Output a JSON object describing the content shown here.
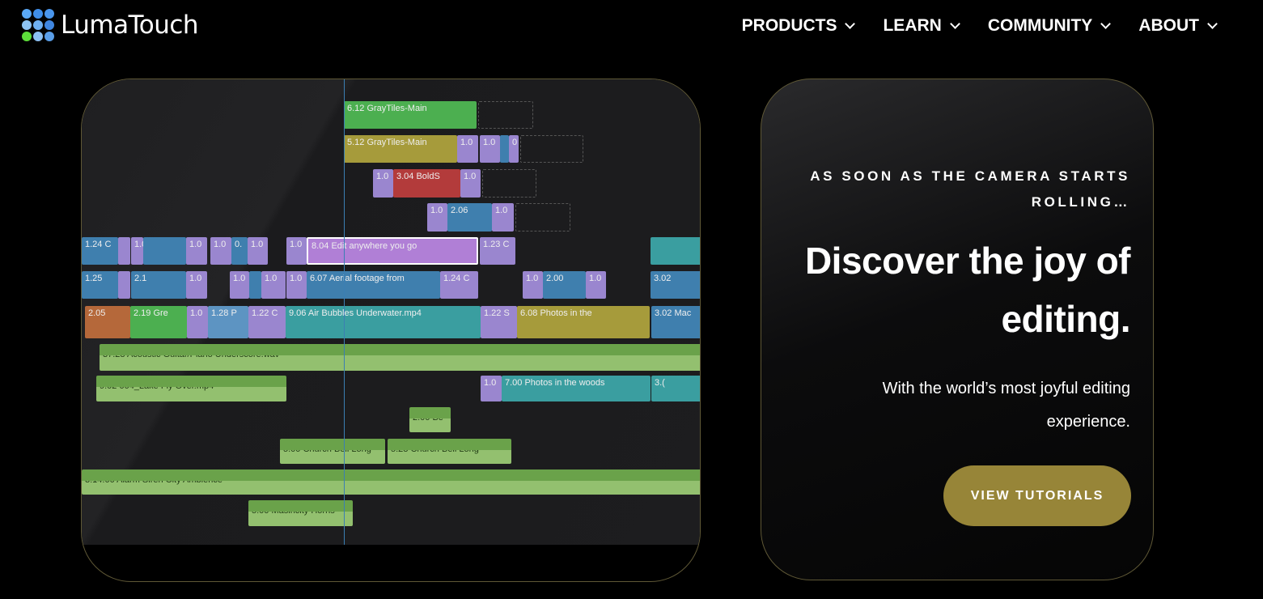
{
  "brand": {
    "name": "LumaTouch",
    "dot_colors": [
      "#5aa8f5",
      "#3f8ee8",
      "#4a96ec",
      "#8ec4f4",
      "#6eb0f2",
      "#3f86e0",
      "#5dde3a",
      "#8cc0f2",
      "#5a9ee8"
    ]
  },
  "nav": {
    "items": [
      {
        "label": "PRODUCTS"
      },
      {
        "label": "LEARN"
      },
      {
        "label": "COMMUNITY"
      },
      {
        "label": "ABOUT"
      }
    ]
  },
  "timeline": {
    "clips": [
      {
        "label": "6.12  GrayTiles-Main",
        "color": "#4caf50"
      },
      {
        "label": "",
        "color": "dash"
      },
      {
        "label": "5.12  GrayTiles-Main",
        "color": "#a69b3b"
      },
      {
        "label": "1.0",
        "color": "#9a86cf"
      },
      {
        "label": "1.0",
        "color": "#9a86cf"
      },
      {
        "label": "",
        "color": "#3f7fae"
      },
      {
        "label": "0",
        "color": "#9a86cf"
      },
      {
        "label": "",
        "color": "dash"
      },
      {
        "label": "1.0",
        "color": "#9a86cf"
      },
      {
        "label": "3.04  BoldS",
        "color": "#b33b3b"
      },
      {
        "label": "1.0",
        "color": "#9a86cf"
      },
      {
        "label": "",
        "color": "dash"
      },
      {
        "label": "1.0",
        "color": "#9a86cf"
      },
      {
        "label": "2.06",
        "color": "#3f7fae"
      },
      {
        "label": "1.0",
        "color": "#9a86cf"
      },
      {
        "label": "",
        "color": "dash"
      },
      {
        "label": "1.24  C",
        "color": "#3f7fae"
      },
      {
        "label": "",
        "color": "#9a86cf"
      },
      {
        "label": "1.0",
        "color": "#9a86cf"
      },
      {
        "label": "",
        "color": "#3f7fae"
      },
      {
        "label": "1.0",
        "color": "#9a86cf"
      },
      {
        "label": "1.0",
        "color": "#9a86cf"
      },
      {
        "label": "0.",
        "color": "#3f7fae"
      },
      {
        "label": "1.0",
        "color": "#9a86cf"
      },
      {
        "label": "1.0",
        "color": "#9a86cf"
      },
      {
        "label": "8.04  Edit anywhere you go",
        "color": "#b07fd6"
      },
      {
        "label": "1.23  C",
        "color": "#9a86cf"
      },
      {
        "label": "",
        "color": "#3a9ea0"
      },
      {
        "label": "1.25",
        "color": "#3f7fae"
      },
      {
        "label": "",
        "color": "#9a86cf"
      },
      {
        "label": "2.1",
        "color": "#3f7fae"
      },
      {
        "label": "1.0",
        "color": "#9a86cf"
      },
      {
        "label": "1.0",
        "color": "#9a86cf"
      },
      {
        "label": "",
        "color": "#3f7fae"
      },
      {
        "label": "1.0",
        "color": "#9a86cf"
      },
      {
        "label": "1.0",
        "color": "#9a86cf"
      },
      {
        "label": "6.07  Aerial footage from",
        "color": "#3f7fae"
      },
      {
        "label": "1.24  C",
        "color": "#9a86cf"
      },
      {
        "label": "1.0",
        "color": "#9a86cf"
      },
      {
        "label": "2.00",
        "color": "#3f7fae"
      },
      {
        "label": "1.0",
        "color": "#9a86cf"
      },
      {
        "label": "3.02",
        "color": "#3f7fae"
      },
      {
        "label": "2.05",
        "color": "#b5683a"
      },
      {
        "label": "2.19  Gre",
        "color": "#4caf50"
      },
      {
        "label": "1.0",
        "color": "#9a86cf"
      },
      {
        "label": "1.28  P",
        "color": "#5d94c2"
      },
      {
        "label": "1.22  C",
        "color": "#9a86cf"
      },
      {
        "label": "9.06  Air Bubbles Underwater.mp4",
        "color": "#3a9ea0"
      },
      {
        "label": "1.22  S",
        "color": "#9a86cf"
      },
      {
        "label": "6.08  Photos in the",
        "color": "#a69b3b"
      },
      {
        "label": "3.02  Mac",
        "color": "#3f7fae"
      },
      {
        "label": "37.28  Acoustic Guitar/Piano Underscore.wav",
        "color": "audio"
      },
      {
        "label": "9.02  004_Lake Fly Over.mp4",
        "color": "audio"
      },
      {
        "label": "1.0",
        "color": "#9a86cf"
      },
      {
        "label": "7.00  Photos in the woods",
        "color": "#3a9ea0"
      },
      {
        "label": "3.(",
        "color": "#3a9ea0"
      },
      {
        "label": "2.00  Be",
        "color": "audio"
      },
      {
        "label": "5.00  Church Bell Long",
        "color": "audio"
      },
      {
        "label": "5.28  Church Bell Long",
        "color": "audio"
      },
      {
        "label": "3:14.00  Alarm Siren City Ambience",
        "color": "audio"
      },
      {
        "label": "5.00  Masincity Horns",
        "color": "audio"
      }
    ]
  },
  "hero": {
    "eyebrow": "AS SOON AS THE CAMERA STARTS ROLLING…",
    "headline": "Discover the joy of editing.",
    "subtext": "With the world’s most joyful editing experience.",
    "cta_label": "VIEW TUTORIALS",
    "cta_color": "#978538"
  }
}
